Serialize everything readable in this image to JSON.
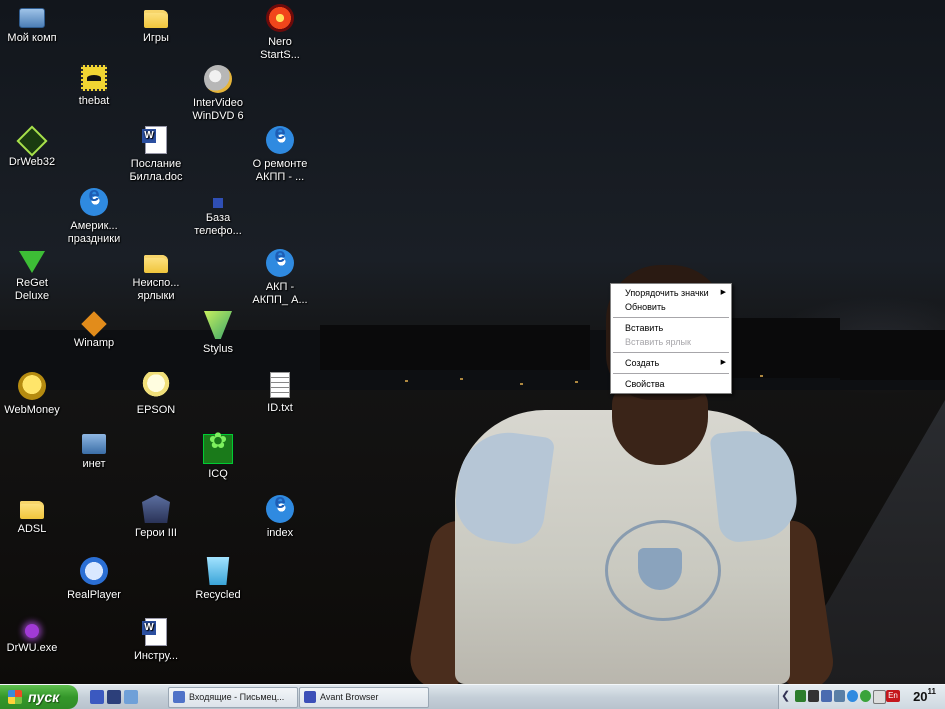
{
  "desktop": {
    "icons": [
      {
        "label": "Мой комп",
        "icon": "computer-icon"
      },
      {
        "label": "Игры",
        "icon": "folder-icon"
      },
      {
        "label": "Nero\nStartS...",
        "icon": "nero-icon"
      },
      {
        "label": "thebat",
        "icon": "bat-icon"
      },
      {
        "label": "InterVideo\nWinDVD 6",
        "icon": "windvd-icon"
      },
      {
        "label": "DrWeb32",
        "icon": "drweb-icon"
      },
      {
        "label": "Послание\nБилла.doc",
        "icon": "word-doc-icon"
      },
      {
        "label": "О ремонте\nАКПП - ...",
        "icon": "ie-document-icon"
      },
      {
        "label": "Америк...\nпраздники",
        "icon": "ie-document-icon"
      },
      {
        "label": "База\nтелефо...",
        "icon": "database-icon"
      },
      {
        "label": "ReGet\nDeluxe",
        "icon": "reget-icon"
      },
      {
        "label": "Неиспо...\nярлыки",
        "icon": "folder-icon"
      },
      {
        "label": "АКП -\nАКПП_ А...",
        "icon": "ie-document-icon"
      },
      {
        "label": "Winamp",
        "icon": "winamp-icon"
      },
      {
        "label": "Stylus",
        "icon": "stylus-icon"
      },
      {
        "label": "WebMoney",
        "icon": "webmoney-icon"
      },
      {
        "label": "EPSON",
        "icon": "bulb-icon"
      },
      {
        "label": "ID.txt",
        "icon": "text-file-icon"
      },
      {
        "label": "инет",
        "icon": "network-icon"
      },
      {
        "label": "ICQ",
        "icon": "icq-icon"
      },
      {
        "label": "ADSL",
        "icon": "folder-icon"
      },
      {
        "label": "Герои III",
        "icon": "heroes-icon"
      },
      {
        "label": "index",
        "icon": "ie-document-icon"
      },
      {
        "label": "RealPlayer",
        "icon": "realplayer-icon"
      },
      {
        "label": "Recycled",
        "icon": "recycle-bin-icon"
      },
      {
        "label": "DrWU.exe",
        "icon": "drwu-icon"
      },
      {
        "label": "Инстру...",
        "icon": "word-doc-icon"
      }
    ]
  },
  "context_menu": {
    "arrange_icons": "Упорядочить значки",
    "refresh": "Обновить",
    "paste": "Вставить",
    "paste_shortcut": "Вставить ярлык",
    "new": "Создать",
    "properties": "Свойства",
    "submenu_arrow": "▶"
  },
  "taskbar": {
    "start_label": "пуск",
    "tasks": [
      {
        "label": "Входящие - Письмец...",
        "icon": "mail-icon"
      },
      {
        "label": "Avant Browser",
        "icon": "avant-browser-icon"
      }
    ],
    "tray": {
      "arrow": "❮",
      "language": "En",
      "clock_hours": "20",
      "clock_minutes": "11"
    }
  },
  "colors": {
    "taskbar": "#c5cfd8",
    "start_button": "#34972a",
    "menu_disabled": "#a7a6aa"
  }
}
